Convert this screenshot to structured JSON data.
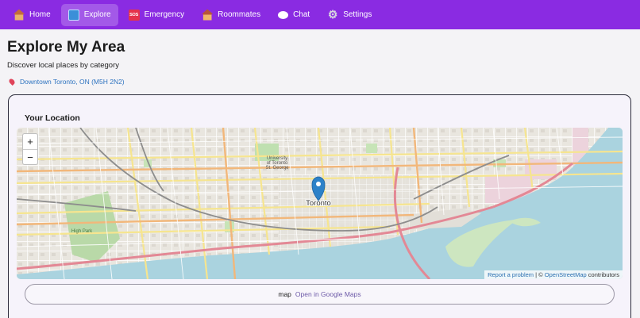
{
  "nav": {
    "items": [
      {
        "label": "Home",
        "icon": "home-icon",
        "active": false
      },
      {
        "label": "Explore",
        "icon": "map-icon",
        "active": true
      },
      {
        "label": "Emergency",
        "icon": "sos-icon",
        "active": false
      },
      {
        "label": "Roommates",
        "icon": "house-icon",
        "active": false
      },
      {
        "label": "Chat",
        "icon": "chat-bubble-icon",
        "active": false
      },
      {
        "label": "Settings",
        "icon": "gear-icon",
        "active": false
      }
    ],
    "sos_text": "SOS",
    "background": "#8a2be2"
  },
  "header": {
    "title": "Explore My Area",
    "subtitle": "Discover local places by category",
    "location": "Downtown Toronto, ON (M5H 2N2)"
  },
  "card": {
    "title": "Your Location",
    "map": {
      "city_label": "Toronto",
      "university_label_lines": [
        "University",
        "of Toronto",
        "St. George"
      ],
      "park_label": "High Park",
      "zoom_in": "+",
      "zoom_out": "−",
      "attribution": {
        "report": "Report a problem",
        "sep": " | © ",
        "osm": "OpenStreetMap",
        "suffix": " contributors"
      }
    },
    "button": {
      "icon_word": "map",
      "label": "Open in Google Maps"
    }
  }
}
